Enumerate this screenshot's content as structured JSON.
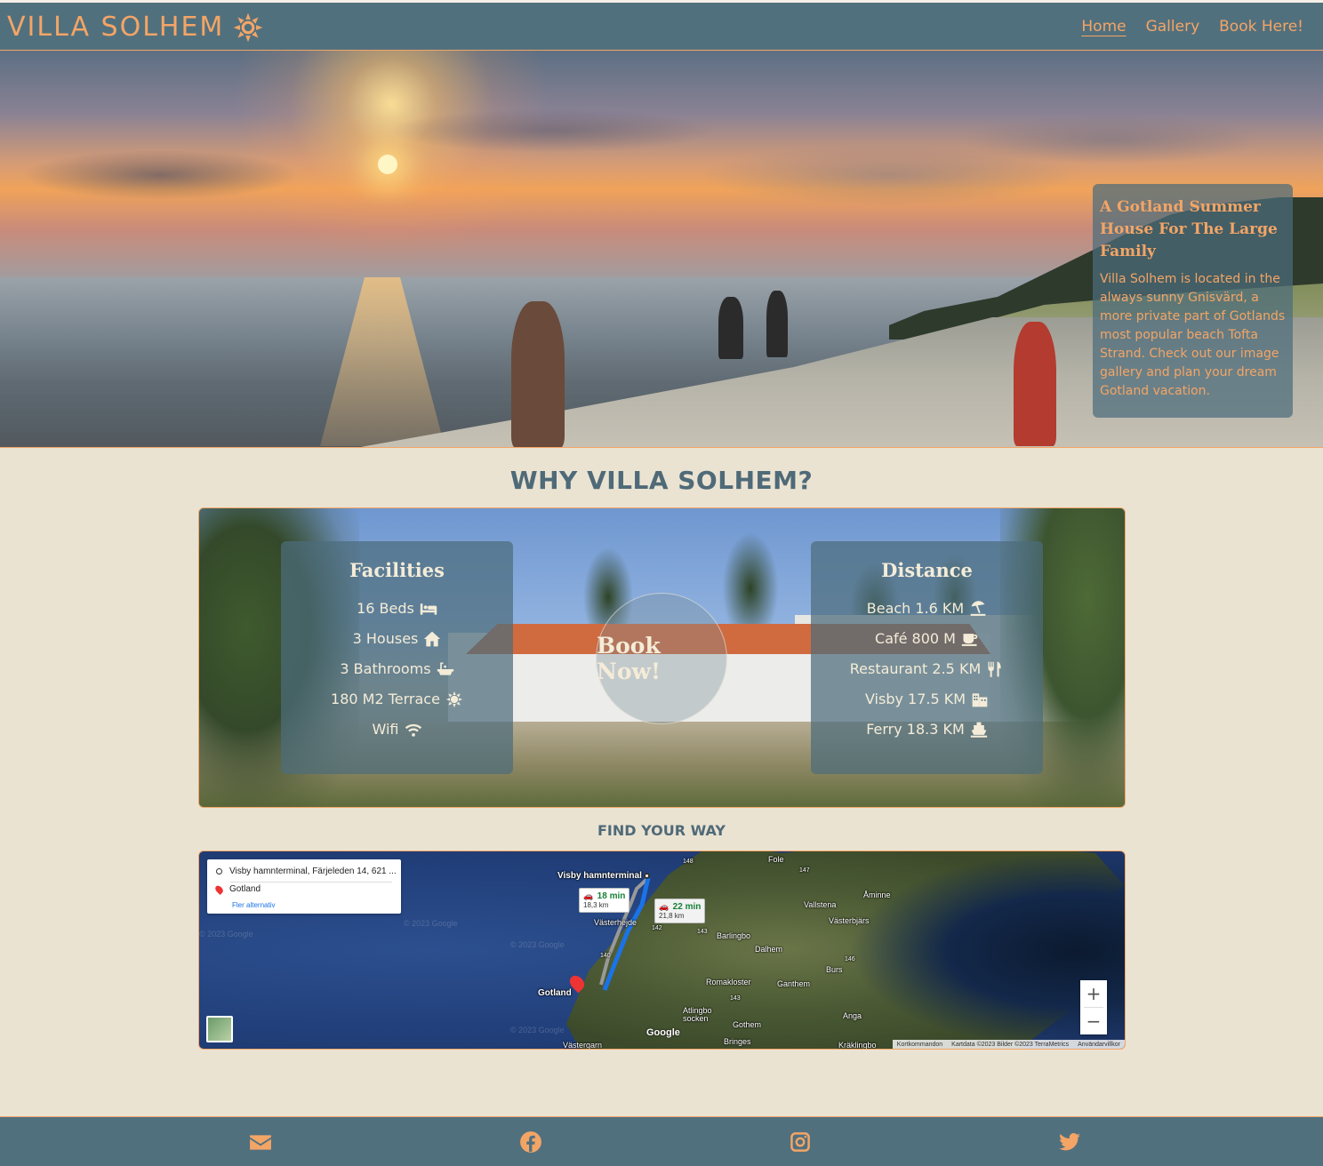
{
  "nav": {
    "brand": "VILLA SOLHEM",
    "brand_icon": "sun-icon",
    "links": [
      "Home",
      "Gallery",
      "Book Here!"
    ],
    "active": "Home"
  },
  "hero": {
    "title": "A Gotland Summer House For The Large Family",
    "text": "Villa Solhem is located in the always sunny Gnisvärd, a more private part of Gotlands most popular beach Tofta Strand. Check out our image gallery and plan your dream Gotland vacation."
  },
  "why": {
    "title": "WHY VILLA SOLHEM?",
    "facilities": {
      "heading": "Facilities",
      "items": [
        {
          "label": "16 Beds",
          "icon": "bed-icon"
        },
        {
          "label": "3 Houses",
          "icon": "house-icon"
        },
        {
          "label": "3 Bathrooms",
          "icon": "bath-icon"
        },
        {
          "label": "180 M2 Terrace",
          "icon": "sun-icon"
        },
        {
          "label": "Wifi",
          "icon": "wifi-icon"
        }
      ]
    },
    "distance": {
      "heading": "Distance",
      "items": [
        {
          "label": "Beach 1.6 KM",
          "icon": "umbrella-beach-icon"
        },
        {
          "label": "Café 800 M",
          "icon": "coffee-icon"
        },
        {
          "label": "Restaurant 2.5 KM",
          "icon": "utensils-icon"
        },
        {
          "label": "Visby 17.5 KM",
          "icon": "city-icon"
        },
        {
          "label": "Ferry 18.3 KM",
          "icon": "ship-icon"
        }
      ]
    },
    "book_now": "Book Now!"
  },
  "map": {
    "title": "FIND YOUR WAY",
    "origin": "Visby hamnterminal, Färjeleden 14, 621 ...",
    "destination": "Gotland",
    "more_options": "Fler alternativ",
    "route1": {
      "time": "18 min",
      "distance": "18,3 km"
    },
    "route2": {
      "time": "22 min",
      "distance": "21,8 km"
    },
    "places": [
      "Visby hamnterminal",
      "Gotland",
      "Västerhejde",
      "Barlingbo",
      "Dalhem",
      "Romakloster",
      "Ganthem",
      "Vallstena",
      "Västerbjärs",
      "Åminne",
      "Burs",
      "Anga",
      "Atlingbo socken",
      "Gothem",
      "Fole",
      "Bringes",
      "Västergarn",
      "Kräklingbo"
    ],
    "road_numbers": [
      "148",
      "147",
      "142",
      "143",
      "140",
      "146",
      "143"
    ],
    "watermark": "© 2023 Google",
    "google": "Google",
    "attribution": [
      "Kortkommandon",
      "Kartdata ©2023 Bilder ©2023 TerraMetrics",
      "Användarvillkor"
    ],
    "zoom_in": "+",
    "zoom_out": "−"
  },
  "footer": {
    "icons": [
      "envelope-icon",
      "facebook-icon",
      "instagram-icon",
      "twitter-icon"
    ]
  },
  "colors": {
    "accent": "#f3a566",
    "nav_bg": "#51707e",
    "page_bg": "#ebe3d2",
    "text": "#4f6a78"
  }
}
